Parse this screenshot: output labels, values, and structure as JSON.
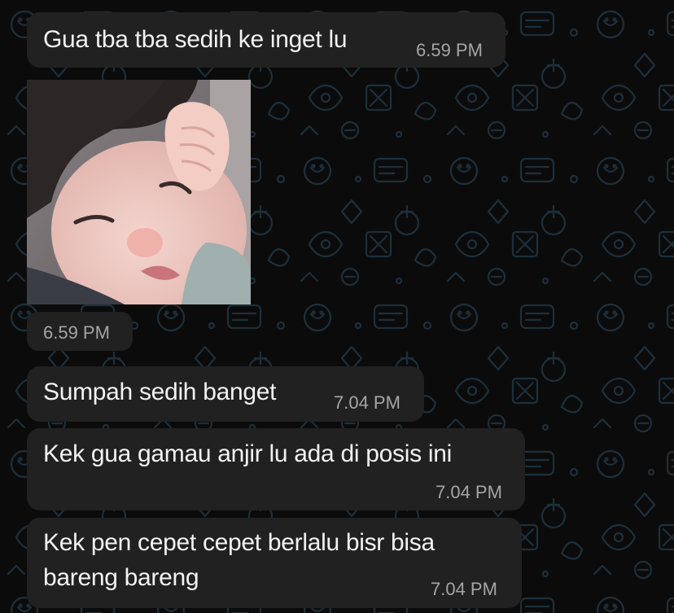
{
  "chat": {
    "messages": [
      {
        "text": "Gua tba tba sedih ke inget lu",
        "time": "6.59 PM"
      },
      {
        "type": "image",
        "image_desc": "photo-of-crying-toddler",
        "time": "6.59 PM"
      },
      {
        "text": "Sumpah sedih banget",
        "time": "7.04 PM"
      },
      {
        "text": "Kek gua gamau anjir lu ada di posis ini",
        "time": "7.04 PM"
      },
      {
        "text": "Kek pen cepet cepet berlalu bisr bisa\nbareng bareng",
        "time": "7.04 PM"
      }
    ]
  },
  "colors": {
    "background": "#0b0b0b",
    "bubble": "#212121",
    "text": "#f2f2f2",
    "timestamp": "#a5a5a5",
    "doodle": "#1f3340"
  }
}
